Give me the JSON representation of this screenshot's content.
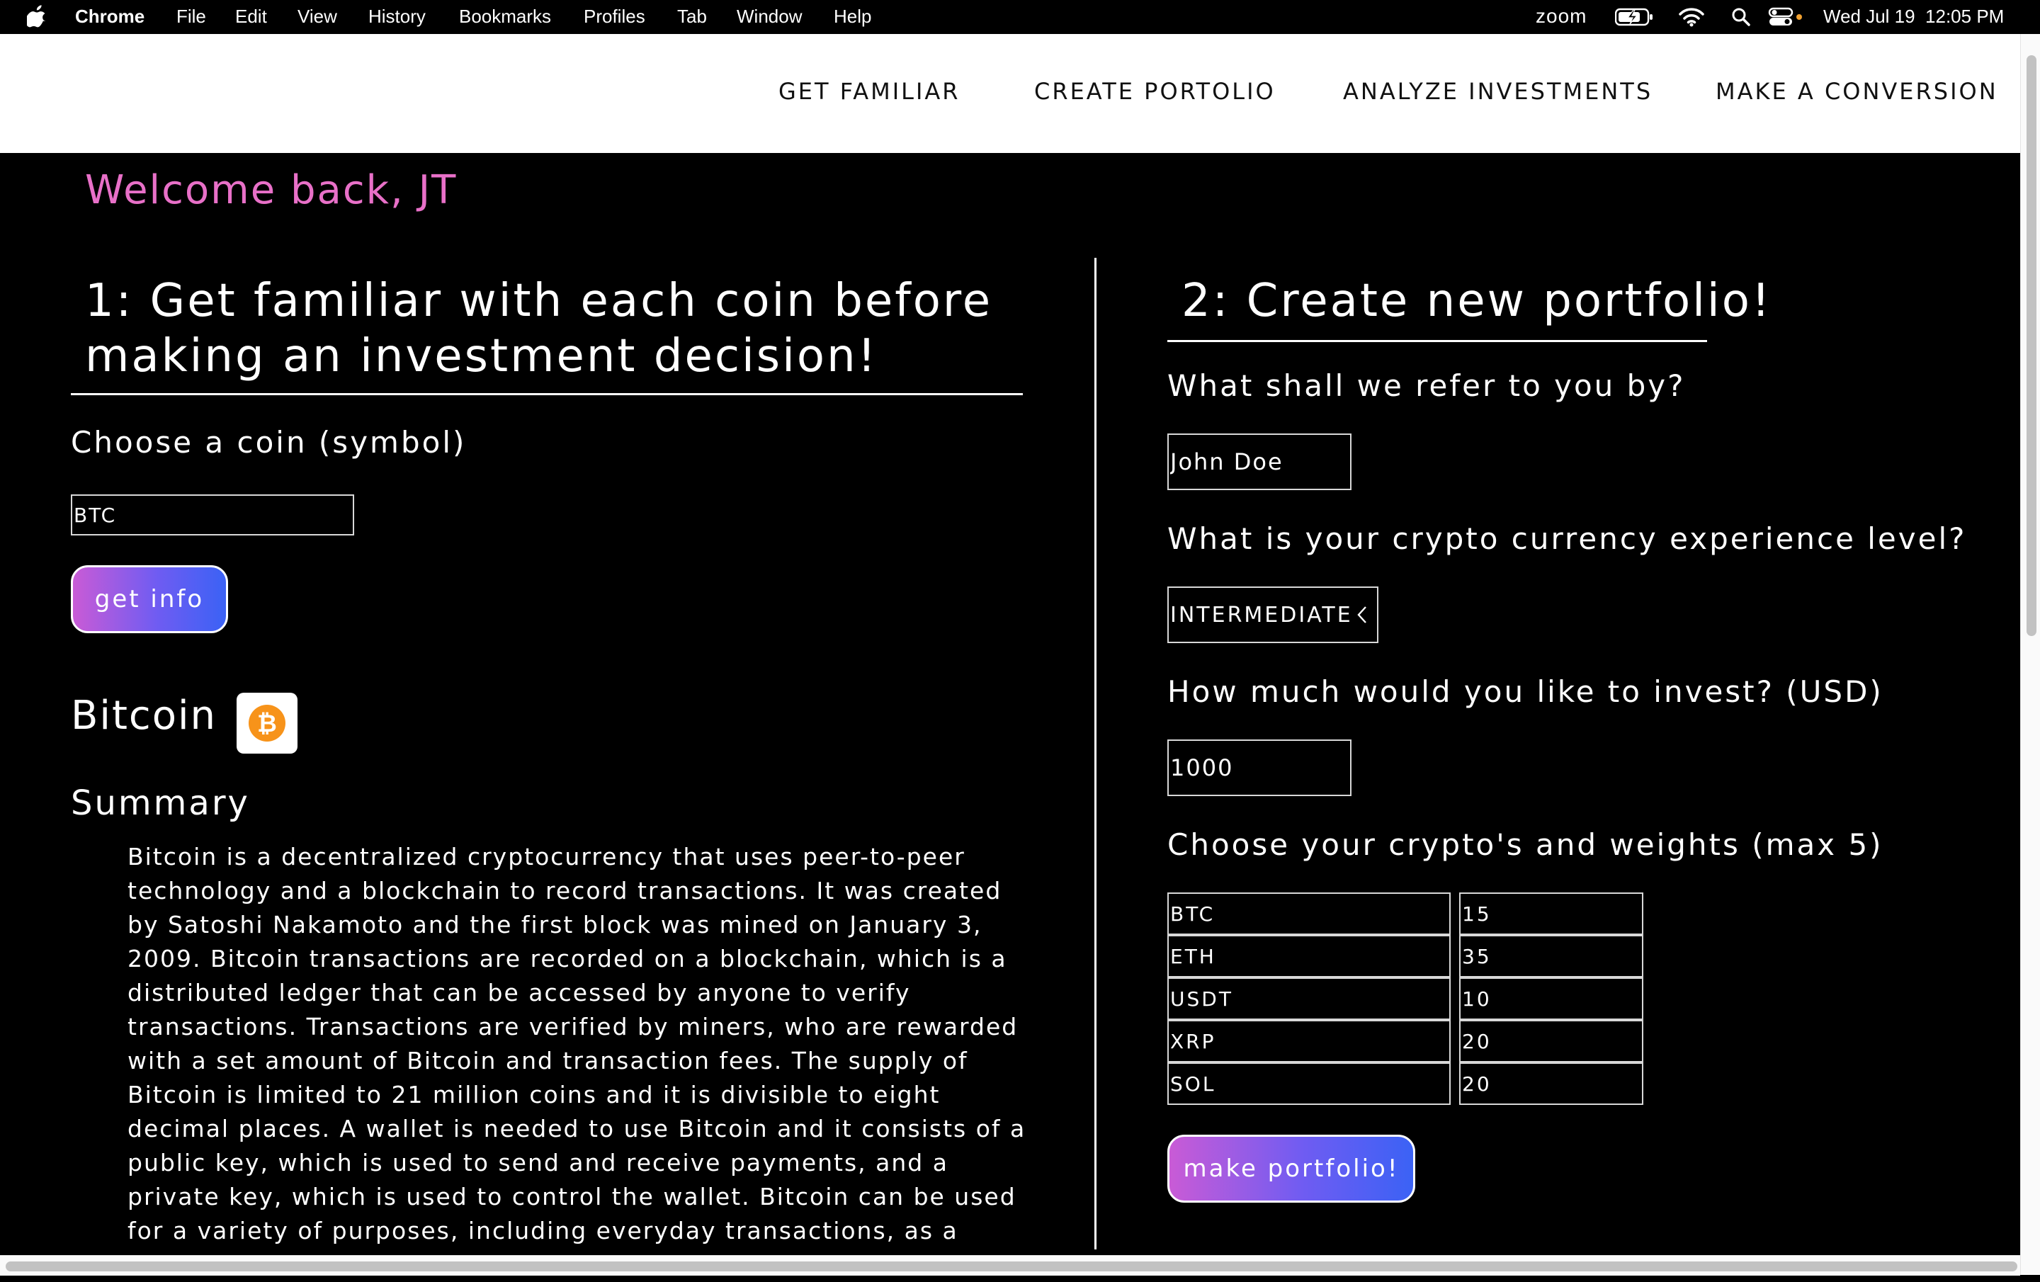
{
  "menubar": {
    "app_name": "Chrome",
    "menus": [
      "File",
      "Edit",
      "View",
      "History",
      "Bookmarks",
      "Profiles",
      "Tab",
      "Window",
      "Help"
    ],
    "status": {
      "zoom_label": "zoom",
      "datetime": "Wed Jul 19  12:05 PM"
    },
    "icons": [
      "apple-icon",
      "battery-charging-icon",
      "wifi-icon",
      "search-icon",
      "control-center-icon"
    ]
  },
  "nav": {
    "links": [
      "GET FAMILIAR",
      "CREATE PORTOLIO",
      "ANALYZE INVESTMENTS",
      "MAKE A CONVERSION"
    ]
  },
  "welcome": "Welcome back, JT",
  "familiar": {
    "heading_line1": "1: Get familiar with each coin before",
    "heading_line2": "making an investment decision!",
    "choose_label": "Choose a coin (symbol)",
    "coin_input_value": "BTC",
    "get_info_label": "get info",
    "coin_name": "Bitcoin",
    "coin_icon": "bitcoin-icon",
    "summary_heading": "Summary",
    "summary_text": "Bitcoin is a decentralized cryptocurrency that uses peer-to-peer technology and a blockchain to record transactions. It was created by Satoshi Nakamoto and the first block was mined on January 3, 2009. Bitcoin transactions are recorded on a blockchain, which is a distributed ledger that can be accessed by anyone to verify transactions. Transactions are verified by miners, who are rewarded with a set amount of Bitcoin and transaction fees. The supply of Bitcoin is limited to 21 million coins and it is divisible to eight decimal places. A wallet is needed to use Bitcoin and it consists of a public key, which is used to send and receive payments, and a private key, which is used to control the wallet. Bitcoin can be used for a variety of purposes, including everyday transactions, as a store of value, or for investment."
  },
  "portfolio": {
    "heading": "2: Create new portfolio!",
    "name_label": "What shall we refer to you by?",
    "name_value": "John Doe",
    "experience_label": "What is your crypto currency experience level?",
    "experience_value": "INTERMEDIATE",
    "invest_label": "How much would you like to invest? (USD)",
    "invest_value": "1000",
    "weights_label": "Choose your crypto's and weights (max 5)",
    "rows": [
      {
        "coin": "BTC",
        "weight": "15"
      },
      {
        "coin": "ETH",
        "weight": "35"
      },
      {
        "coin": "USDT",
        "weight": "10"
      },
      {
        "coin": "XRP",
        "weight": "20"
      },
      {
        "coin": "SOL",
        "weight": "20"
      }
    ],
    "make_label": "make portfolio!"
  },
  "colors": {
    "welcome": "#e870c8",
    "button_gradient_start": "#c95bd6",
    "button_gradient_end": "#3b62f5",
    "bitcoin_orange": "#f7931a"
  }
}
